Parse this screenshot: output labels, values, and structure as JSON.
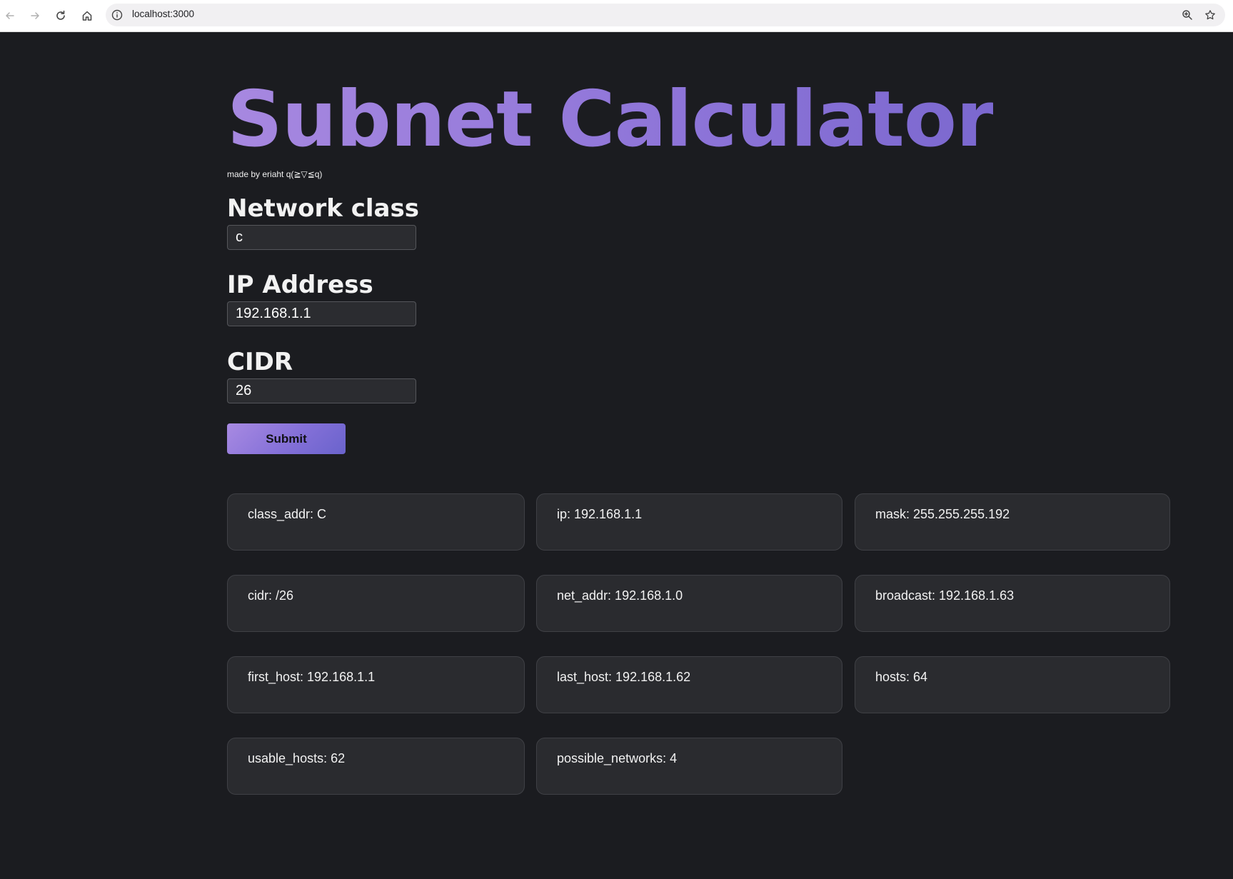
{
  "browser": {
    "url": "localhost:3000"
  },
  "app": {
    "title": "Subnet Calculator",
    "subtitle": "made by eriaht q(≧▽≦q)"
  },
  "form": {
    "network_class": {
      "label": "Network class",
      "value": "c"
    },
    "ip_address": {
      "label": "IP Address",
      "value": "192.168.1.1"
    },
    "cidr": {
      "label": "CIDR",
      "value": "26"
    },
    "submit_label": "Submit"
  },
  "results": [
    "class_addr: C",
    "ip: 192.168.1.1",
    "mask: 255.255.255.192",
    "cidr: /26",
    "net_addr: 192.168.1.0",
    "broadcast: 192.168.1.63",
    "first_host: 192.168.1.1",
    "last_host: 192.168.1.62",
    "hosts: 64",
    "usable_hosts: 62",
    "possible_networks: 4"
  ],
  "icons": {
    "back": "back-arrow-icon",
    "forward": "forward-arrow-icon",
    "reload": "reload-icon",
    "home": "home-icon",
    "site_info": "info-icon",
    "zoom": "zoom-icon",
    "bookmark": "star-icon"
  },
  "colors": {
    "background": "#1b1c20",
    "title_gradient_start": "#a788e0",
    "title_gradient_end": "#7b68cf",
    "card_background": "#2a2b2f"
  }
}
